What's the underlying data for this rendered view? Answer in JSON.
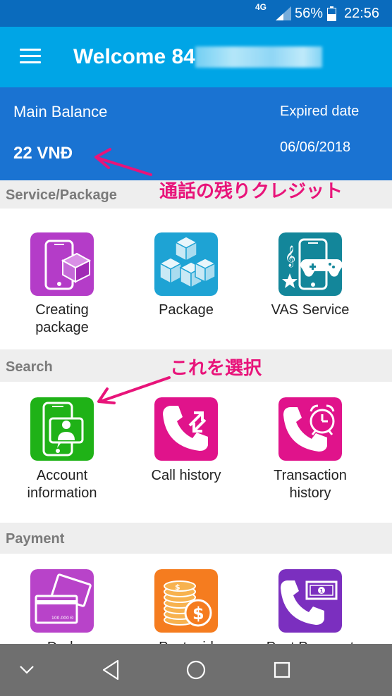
{
  "status": {
    "network": "4G",
    "battery": "56%",
    "time": "22:56"
  },
  "header": {
    "title": "Welcome 84"
  },
  "balance": {
    "label": "Main Balance",
    "value": "22 VNĐ",
    "expired_label": "Expired date",
    "expired_value": "06/06/2018"
  },
  "annotations": {
    "balance_note": "通話の残りクレジット",
    "select_note": "これを選択"
  },
  "sections": {
    "service": {
      "title": "Service/Package",
      "items": [
        {
          "line1": "Creating",
          "line2": "package",
          "icon": "phone-box-icon",
          "color": "#b43cc8"
        },
        {
          "line1": "Package",
          "line2": "",
          "icon": "boxes-icon",
          "color": "#1ea3d4"
        },
        {
          "line1": "VAS Service",
          "line2": "",
          "icon": "phone-game-icon",
          "color": "#13869a"
        }
      ]
    },
    "search": {
      "title": "Search",
      "items": [
        {
          "line1": "Account",
          "line2": "information",
          "icon": "account-phone-icon",
          "color": "#1fb217"
        },
        {
          "line1": "Call history",
          "line2": "",
          "icon": "call-history-icon",
          "color": "#e0138b"
        },
        {
          "line1": "Transaction",
          "line2": "history",
          "icon": "phone-clock-icon",
          "color": "#e0138b"
        }
      ]
    },
    "payment": {
      "title": "Payment",
      "items": [
        {
          "line1": "Dork",
          "line2": "",
          "icon": "cards-icon",
          "color": "#b843c9",
          "card_text": "100.000 Đ"
        },
        {
          "line1": "Postpaid",
          "line2": "",
          "icon": "coins-icon",
          "color": "#f57c1f"
        },
        {
          "line1": "Post Payment",
          "line2": "",
          "icon": "phone-money-icon",
          "color": "#7b2fbf"
        }
      ]
    }
  }
}
